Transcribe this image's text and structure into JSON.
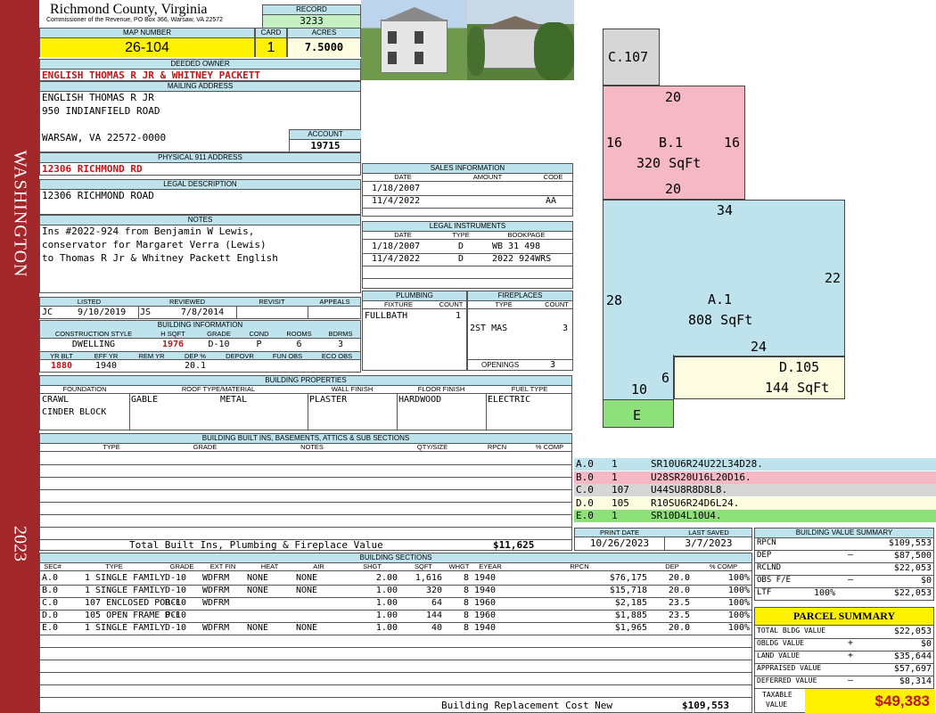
{
  "sidebar": {
    "district": "WASHINGTON",
    "year": "2023"
  },
  "header": {
    "county": "Richmond County, Virginia",
    "commissioner": "Commissioner of the Revenue, PO Box 366, Warsaw, VA 22572",
    "record_label": "RECORD",
    "record": "3233",
    "map_label": "MAP NUMBER",
    "map_number": "26-104",
    "card_label": "CARD",
    "card": "1",
    "acres_label": "ACRES",
    "acres": "7.5000"
  },
  "owner": {
    "deeded_label": "DEEDED OWNER",
    "deeded": "ENGLISH THOMAS R JR & WHITNEY PACKETT",
    "mailing_label": "MAILING ADDRESS",
    "mail_line1": "ENGLISH THOMAS R JR",
    "mail_line2": "950 INDIANFIELD ROAD",
    "mail_line3": "WARSAW, VA 22572-0000",
    "account_label": "ACCOUNT",
    "account": "19715",
    "physical_label": "PHYSICAL 911 ADDRESS",
    "physical": "12306 RICHMOND RD",
    "legal_label": "LEGAL DESCRIPTION",
    "legal": "12306 RICHMOND ROAD",
    "notes_label": "NOTES",
    "notes1": "Ins #2022-924 from Benjamin W Lewis,",
    "notes2": "conservator for Margaret Verra (Lewis)",
    "notes3": "to Thomas R Jr & Whitney Packett English"
  },
  "listing": {
    "listed_label": "LISTED",
    "reviewed_label": "REVIEWED",
    "revisit_label": "REVISIT",
    "appeals_label": "APPEALS",
    "listed_by": "JC",
    "listed_date": "9/10/2019",
    "reviewed_by": "JS",
    "reviewed_date": "7/8/2014"
  },
  "building_info": {
    "header": "BUILDING INFORMATION",
    "h1": "CONSTRUCTION STYLE",
    "h2": "H SQFT",
    "h3": "GRADE",
    "h4": "COND",
    "h5": "ROOMS",
    "h6": "BDRMS",
    "style": "DWELLING",
    "hsqft": "1976",
    "grade": "D-10",
    "cond": "P",
    "rooms": "6",
    "bdrms": "3",
    "h7": "YR BLT",
    "h8": "EFF YR",
    "h9": "REM YR",
    "h10": "DEP %",
    "h11": "DEPOVR",
    "h12": "FUN OBS",
    "h13": "ECO OBS",
    "yrblt": "1880",
    "effyr": "1940",
    "remyr": "",
    "dep": "20.1"
  },
  "sales": {
    "header": "SALES INFORMATION",
    "h_date": "DATE",
    "h_amount": "AMOUNT",
    "h_code": "CODE",
    "rows": [
      {
        "date": "1/18/2007",
        "amount": "",
        "code": ""
      },
      {
        "date": "11/4/2022",
        "amount": "",
        "code": "AA"
      }
    ]
  },
  "instruments": {
    "header": "LEGAL INSTRUMENTS",
    "h_date": "DATE",
    "h_type": "TYPE",
    "h_book": "BOOKPAGE",
    "rows": [
      {
        "date": "1/18/2007",
        "type": "D",
        "book": "WB 31 498"
      },
      {
        "date": "11/4/2022",
        "type": "D",
        "book": "2022 924WRS"
      }
    ]
  },
  "plumbing": {
    "header": "PLUMBING",
    "h_fixture": "FIXTURE",
    "h_count": "COUNT",
    "fixture": "FULLBATH",
    "count": "1"
  },
  "fireplaces": {
    "header": "FIREPLACES",
    "h_type": "TYPE",
    "h_count": "COUNT",
    "type": "2ST MAS",
    "count": "3",
    "openings_label": "OPENINGS",
    "openings": "3"
  },
  "properties": {
    "header": "BUILDING PROPERTIES",
    "h_found": "FOUNDATION",
    "h_roof": "ROOF TYPE/MATERIAL",
    "h_wall": "WALL FINISH",
    "h_floor": "FLOOR FINISH",
    "h_fuel": "FUEL TYPE",
    "found1": "CRAWL",
    "found2": "CINDER BLOCK",
    "roof_type": "GABLE",
    "roof_mat": "METAL",
    "wall": "PLASTER",
    "floor": "HARDWOOD",
    "fuel": "ELECTRIC"
  },
  "builtins": {
    "header": "BUILDING BUILT INS, BASEMENTS, ATTICS & SUB SECTIONS",
    "h_type": "TYPE",
    "h_grade": "GRADE",
    "h_notes": "NOTES",
    "h_qty": "QTY/SIZE",
    "h_rpcn": "RPCN",
    "h_comp": "% COMP",
    "total_label": "Total Built Ins, Plumbing & Fireplace Value",
    "total": "$11,625"
  },
  "print": {
    "print_label": "PRINT DATE",
    "print_date": "10/26/2023",
    "saved_label": "LAST SAVED",
    "saved_date": "3/7/2023"
  },
  "sections": {
    "header": "BUILDING SECTIONS",
    "cols": [
      "SEC#",
      "TYPE",
      "GRADE",
      "EXT FIN",
      "HEAT",
      "AIR",
      "SHGT",
      "SQFT",
      "WHGT",
      "EYEAR",
      "RPCN",
      "DEP",
      "% COMP"
    ],
    "rows": [
      {
        "sec": "A.0",
        "type": "1 SINGLE FAMILY",
        "grade": "D-10",
        "ext": "WDFRM",
        "heat": "NONE",
        "air": "NONE",
        "shgt": "2.00",
        "sqft": "1,616",
        "whgt": "8",
        "eyear": "1940",
        "rpcn": "$76,175",
        "dep": "20.0",
        "comp": "100%"
      },
      {
        "sec": "B.0",
        "type": "1 SINGLE FAMILY",
        "grade": "D-10",
        "ext": "WDFRM",
        "heat": "NONE",
        "air": "NONE",
        "shgt": "1.00",
        "sqft": "320",
        "whgt": "8",
        "eyear": "1940",
        "rpcn": "$15,718",
        "dep": "20.0",
        "comp": "100%"
      },
      {
        "sec": "C.0",
        "type": "107 ENCLOSED PORCH",
        "grade": "D-10",
        "ext": "WDFRM",
        "heat": "",
        "air": "",
        "shgt": "1.00",
        "sqft": "64",
        "whgt": "8",
        "eyear": "1960",
        "rpcn": "$2,185",
        "dep": "23.5",
        "comp": "100%"
      },
      {
        "sec": "D.0",
        "type": "105 OPEN FRAME PCH",
        "grade": "D-10",
        "ext": "",
        "heat": "",
        "air": "",
        "shgt": "1.00",
        "sqft": "144",
        "whgt": "8",
        "eyear": "1960",
        "rpcn": "$1,885",
        "dep": "23.5",
        "comp": "100%"
      },
      {
        "sec": "E.0",
        "type": "1 SINGLE FAMILY",
        "grade": "D-10",
        "ext": "WDFRM",
        "heat": "NONE",
        "air": "NONE",
        "shgt": "1.00",
        "sqft": "40",
        "whgt": "8",
        "eyear": "1940",
        "rpcn": "$1,965",
        "dep": "20.0",
        "comp": "100%"
      }
    ],
    "replacement_label": "Building Replacement Cost New",
    "replacement": "$109,553"
  },
  "sketch": {
    "c_label": "C.107",
    "b_label": "B.1",
    "b_area": "320 SqFt",
    "a_label": "A.1",
    "a_area": "808 SqFt",
    "d_label": "D.105",
    "d_area": "144 SqFt",
    "e_label": "E",
    "dims": {
      "b_top": "20",
      "b_left": "16",
      "b_right": "16",
      "b_bottom": "20",
      "a_top": "34",
      "a_left": "28",
      "a_right": "22",
      "a_mid": "24",
      "a_six": "6",
      "a_ten": "10"
    },
    "legend": [
      {
        "code": "A.0",
        "n": "1",
        "path": "SR10U6R24U22L34D28.",
        "color": "#bfe3ec"
      },
      {
        "code": "B.0",
        "n": "1",
        "path": "U28SR20U16L20D16.",
        "color": "#f6b8c4"
      },
      {
        "code": "C.0",
        "n": "107",
        "path": "U44SU8R8D8L8.",
        "color": "#d6d6d6"
      },
      {
        "code": "D.0",
        "n": "105",
        "path": "R10SU6R24D6L24.",
        "color": "#fefce0"
      },
      {
        "code": "E.0",
        "n": "1",
        "path": "SR10D4L10U4.",
        "color": "#8de07a"
      }
    ]
  },
  "bvs": {
    "header": "BUILDING VALUE SUMMARY",
    "rpcn_l": "RPCN",
    "rpcn": "$109,553",
    "dep_l": "DEP",
    "dep_s": "–",
    "dep": "$87,500",
    "rclnd_l": "RCLND",
    "rclnd": "$22,053",
    "obs_l": "OBS F/E",
    "obs_s": "–",
    "obs": "$0",
    "ltf_l": "LTF",
    "ltf_p": "100%",
    "ltf": "$22,053"
  },
  "parcel": {
    "header": "PARCEL SUMMARY",
    "bldg_l": "TOTAL BLDG VALUE",
    "bldg": "$22,053",
    "obldg_l": "OBLDG VALUE",
    "obldg_s": "+",
    "obldg": "$0",
    "land_l": "LAND VALUE",
    "land_s": "+",
    "land": "$35,644",
    "appr_l": "APPRAISED VALUE",
    "appr": "$57,697",
    "def_l": "DEFERRED VALUE",
    "def_s": "–",
    "def": "$8,314",
    "tax_l1": "TAXABLE",
    "tax_l2": "VALUE",
    "tax": "$49,383"
  },
  "colors": {
    "sidebar": "#a3262b",
    "header_bg": "#bfe3ec",
    "yellow": "#fff200",
    "green": "#c4f0c4",
    "red_text": "#c0161b"
  }
}
